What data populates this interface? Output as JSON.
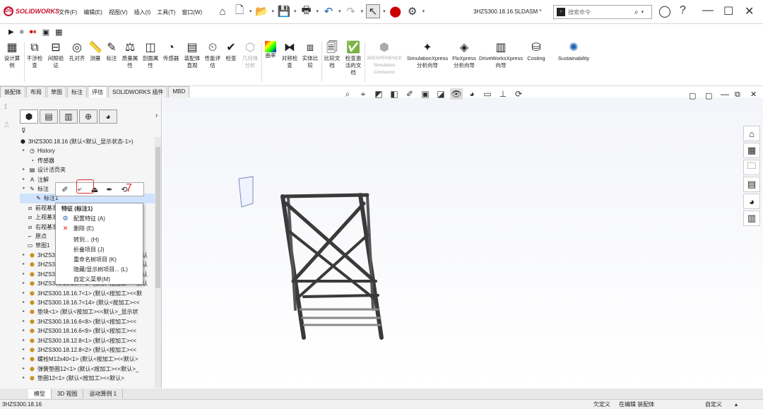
{
  "app": {
    "logo": "SOLIDWORKS",
    "file_title": "3HZS300.18.16.SLDASM *"
  },
  "menus": [
    "文件(F)",
    "编辑(E)",
    "视图(V)",
    "插入(I)",
    "工具(T)",
    "窗口(W)"
  ],
  "search": {
    "placeholder": "搜索命令"
  },
  "commands": [
    {
      "label": "设计算\n例",
      "icon": "design-study-icon"
    },
    {
      "label": "干涉检\n查",
      "icon": "interference-icon"
    },
    {
      "label": "间隙验\n证",
      "icon": "clearance-icon"
    },
    {
      "label": "孔对齐",
      "icon": "hole-align-icon"
    },
    {
      "label": "测量",
      "icon": "measure-icon"
    },
    {
      "label": "标注",
      "icon": "markup-icon"
    },
    {
      "label": "质量属\n性",
      "icon": "mass-props-icon"
    },
    {
      "label": "剖面属\n性",
      "icon": "section-props-icon"
    },
    {
      "label": "传感器",
      "icon": "sensor-icon"
    },
    {
      "label": "装配体\n直观",
      "icon": "assembly-visual-icon"
    },
    {
      "label": "性能评\n估",
      "icon": "performance-icon"
    },
    {
      "label": "检查",
      "icon": "check-icon"
    },
    {
      "label": "几何体\n分析",
      "icon": "geometry-analysis-icon"
    },
    {
      "label": "曲率",
      "icon": "curvature-icon"
    },
    {
      "label": "对称检\n查",
      "icon": "symmetry-icon"
    },
    {
      "label": "实体比\n较",
      "icon": "body-compare-icon"
    },
    {
      "label": "比较文\n档",
      "icon": "compare-docs-icon"
    },
    {
      "label": "检查激\n活的文\n档",
      "icon": "check-active-icon"
    },
    {
      "label": "3DEXPERIENCE\nSimulation\nConnector",
      "icon": "3dx-icon"
    },
    {
      "label": "SimulationXpress\n分析向导",
      "icon": "simxpress-icon"
    },
    {
      "label": "FloXpress\n分析向导",
      "icon": "floxpress-icon"
    },
    {
      "label": "DriveWorksXpress\n向导",
      "icon": "driveworks-icon"
    },
    {
      "label": "Costing",
      "icon": "costing-icon"
    },
    {
      "label": "Sustainability",
      "icon": "sustainability-icon"
    }
  ],
  "tabs": [
    "装配体",
    "布局",
    "草图",
    "标注",
    "评估",
    "SOLIDWORKS 插件",
    "MBD"
  ],
  "tree": [
    "3HZS300.18.16 (默认<默认_显示状态-1>)",
    "History",
    "传感器",
    "设计活页夹",
    "注解",
    "标注",
    "标注1",
    "前视基准面",
    "上视基准面",
    "右视基准面",
    "原点",
    "草图1",
    "3HZS300.18.16.1<1> (默认<按加工><<默认",
    "3HZS300.18.16.2<1> (默认<按加工><<默认",
    "3HZS300.18.16.3<1> (默认<按加工><<默认",
    "3HZS300.18.16.4<1> (默认<按加工><<默认",
    "3HZS300.18.16.7<1> (默认<按加工><<默",
    "3HZS300.18.16.7<14> (默认<按加工><<",
    "垫块<1> (默认<按加工><<默认>_显示状",
    "3HZS300.18.16.6<8> (默认<按加工><<",
    "3HZS300.18.16.6<9> (默认<按加工><<",
    "3HZS300.18.12.8<1> (默认<按加工><<",
    "3HZS300.18.12.8<2> (默认<按加工><<",
    "螺栓M12x40<1> (默认<按加工><<默认>",
    "弹簧垫圈12<1> (默认<按加工><<默认>_",
    "垫圈12<1> (默认<按加工><<默认>"
  ],
  "context_menu": {
    "header": "特征 (标注1)",
    "items": [
      "配置特征 (A)",
      "删除 (E)",
      "转到... (H)",
      "折叠项目 (J)",
      "重命名树项目 (K)",
      "隐藏/显示树项目... (L)",
      "自定义菜单(M)"
    ]
  },
  "annotation_number": "7",
  "bottom_tabs": [
    "模型",
    "3D 视图",
    "运动算例 1"
  ],
  "status": {
    "left": "3HZS300.18.16",
    "s1": "欠定义",
    "s2": "在编辑 装配体",
    "s3": "自定义"
  }
}
